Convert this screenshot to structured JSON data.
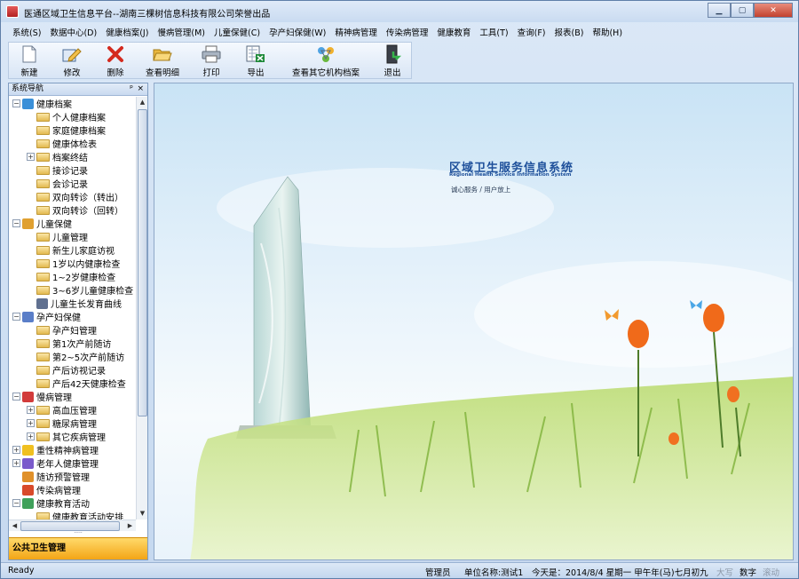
{
  "window": {
    "title": "医通区域卫生信息平台--湖南三棵树信息科技有限公司荣誉出品",
    "controls": [
      "minimize",
      "maximize",
      "close"
    ]
  },
  "menu": [
    "系统(S)",
    "数据中心(D)",
    "健康档案(J)",
    "慢病管理(M)",
    "儿童保健(C)",
    "孕产妇保健(W)",
    "精神病管理",
    "传染病管理",
    "健康教育",
    "工具(T)",
    "查询(F)",
    "报表(B)",
    "帮助(H)"
  ],
  "toolbar": [
    {
      "label": "新建",
      "icon": "new-document-icon"
    },
    {
      "label": "修改",
      "icon": "edit-icon"
    },
    {
      "label": "删除",
      "icon": "delete-icon"
    },
    {
      "label": "查看明细",
      "icon": "open-folder-icon"
    },
    {
      "label": "打印",
      "icon": "printer-icon"
    },
    {
      "label": "导出",
      "icon": "export-excel-icon"
    },
    {
      "label": "查看其它机构档案",
      "icon": "network-icon"
    },
    {
      "label": "退出",
      "icon": "exit-icon"
    }
  ],
  "nav": {
    "title": "系统导航",
    "pin": "ᵖ",
    "close": "×",
    "footer": "公共卫生管理",
    "tree": [
      {
        "label": "健康档案",
        "level": 0,
        "expander": "−",
        "icon": "health-record-icon"
      },
      {
        "label": "个人健康档案",
        "level": 1
      },
      {
        "label": "家庭健康档案",
        "level": 1
      },
      {
        "label": "健康体检表",
        "level": 1
      },
      {
        "label": "档案终结",
        "level": 1,
        "expander": "+"
      },
      {
        "label": "接诊记录",
        "level": 1
      },
      {
        "label": "会诊记录",
        "level": 1
      },
      {
        "label": "双向转诊（转出）",
        "level": 1
      },
      {
        "label": "双向转诊（回转）",
        "level": 1
      },
      {
        "label": "儿童保健",
        "level": 0,
        "expander": "−",
        "icon": "child-care-icon"
      },
      {
        "label": "儿童管理",
        "level": 1
      },
      {
        "label": "新生儿家庭访视",
        "level": 1
      },
      {
        "label": "1岁以内健康检查",
        "level": 1
      },
      {
        "label": "1~2岁健康检查",
        "level": 1
      },
      {
        "label": "3~6岁儿童健康检查",
        "level": 1
      },
      {
        "label": "儿童生长发育曲线",
        "level": 1,
        "icon": "growth-curve-icon"
      },
      {
        "label": "孕产妇保健",
        "level": 0,
        "expander": "−",
        "icon": "maternal-care-icon"
      },
      {
        "label": "孕产妇管理",
        "level": 1
      },
      {
        "label": "第1次产前随访",
        "level": 1
      },
      {
        "label": "第2~5次产前随访",
        "level": 1
      },
      {
        "label": "产后访视记录",
        "level": 1
      },
      {
        "label": "产后42天健康检查",
        "level": 1
      },
      {
        "label": "慢病管理",
        "level": 0,
        "expander": "−",
        "icon": "chronic-disease-icon"
      },
      {
        "label": "高血压管理",
        "level": 1,
        "expander": "+"
      },
      {
        "label": "糖尿病管理",
        "level": 1,
        "expander": "+"
      },
      {
        "label": "其它疾病管理",
        "level": 1,
        "expander": "+"
      },
      {
        "label": "重性精神病管理",
        "level": 0,
        "expander": "+",
        "icon": "warning-icon"
      },
      {
        "label": "老年人健康管理",
        "level": 0,
        "expander": "+",
        "icon": "elderly-care-icon"
      },
      {
        "label": "随访预警管理",
        "level": 0,
        "icon": "followup-alert-icon"
      },
      {
        "label": "传染病管理",
        "level": 0,
        "icon": "infectious-disease-icon"
      },
      {
        "label": "健康教育活动",
        "level": 0,
        "expander": "−",
        "icon": "health-education-icon"
      },
      {
        "label": "健康教育活动安排",
        "level": 1
      }
    ]
  },
  "content": {
    "brand_title": "区域卫生服务信息系统",
    "brand_subtitle": "Regional Health Service Information System",
    "brand_slogan": "诚心服务 / 用户放上"
  },
  "statusbar": {
    "ready": "Ready",
    "user": "管理员",
    "unit": "单位名称:测试1",
    "date": "今天是：2014/8/4 星期一 甲午年(马)七月初九",
    "caps": "大写",
    "num": "数字",
    "scroll": "滚动"
  }
}
